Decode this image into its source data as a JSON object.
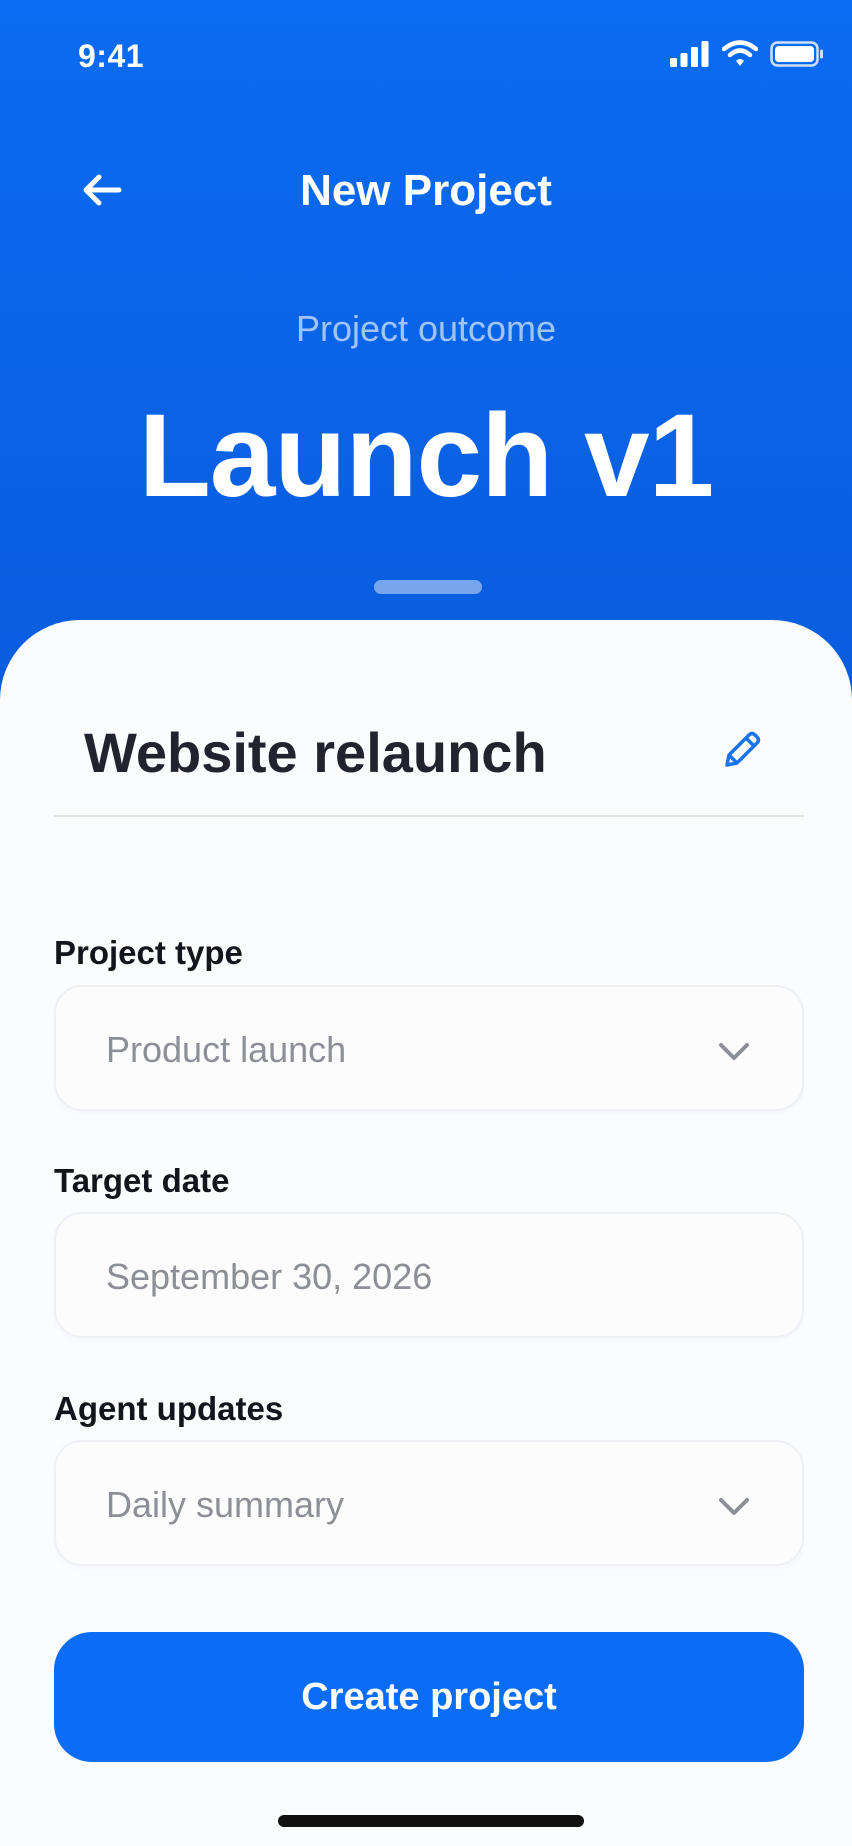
{
  "status_bar": {
    "time": "9:41"
  },
  "header": {
    "title": "New Project",
    "back_icon": "arrow-left-icon"
  },
  "hero": {
    "label": "Project outcome",
    "value": "Launch v1"
  },
  "project": {
    "name": "Website relaunch",
    "edit_icon": "pencil-icon"
  },
  "form": {
    "project_type": {
      "label": "Project type",
      "value": "Product launch"
    },
    "target_date": {
      "label": "Target date",
      "value": "September 30, 2026"
    },
    "agent_updates": {
      "label": "Agent updates",
      "value": "Daily summary"
    }
  },
  "actions": {
    "create_label": "Create project"
  },
  "colors": {
    "brand": "#0a6cf2",
    "cta": "#0a6cf7",
    "text_primary": "#22232e",
    "text_muted": "#8d8f96"
  }
}
